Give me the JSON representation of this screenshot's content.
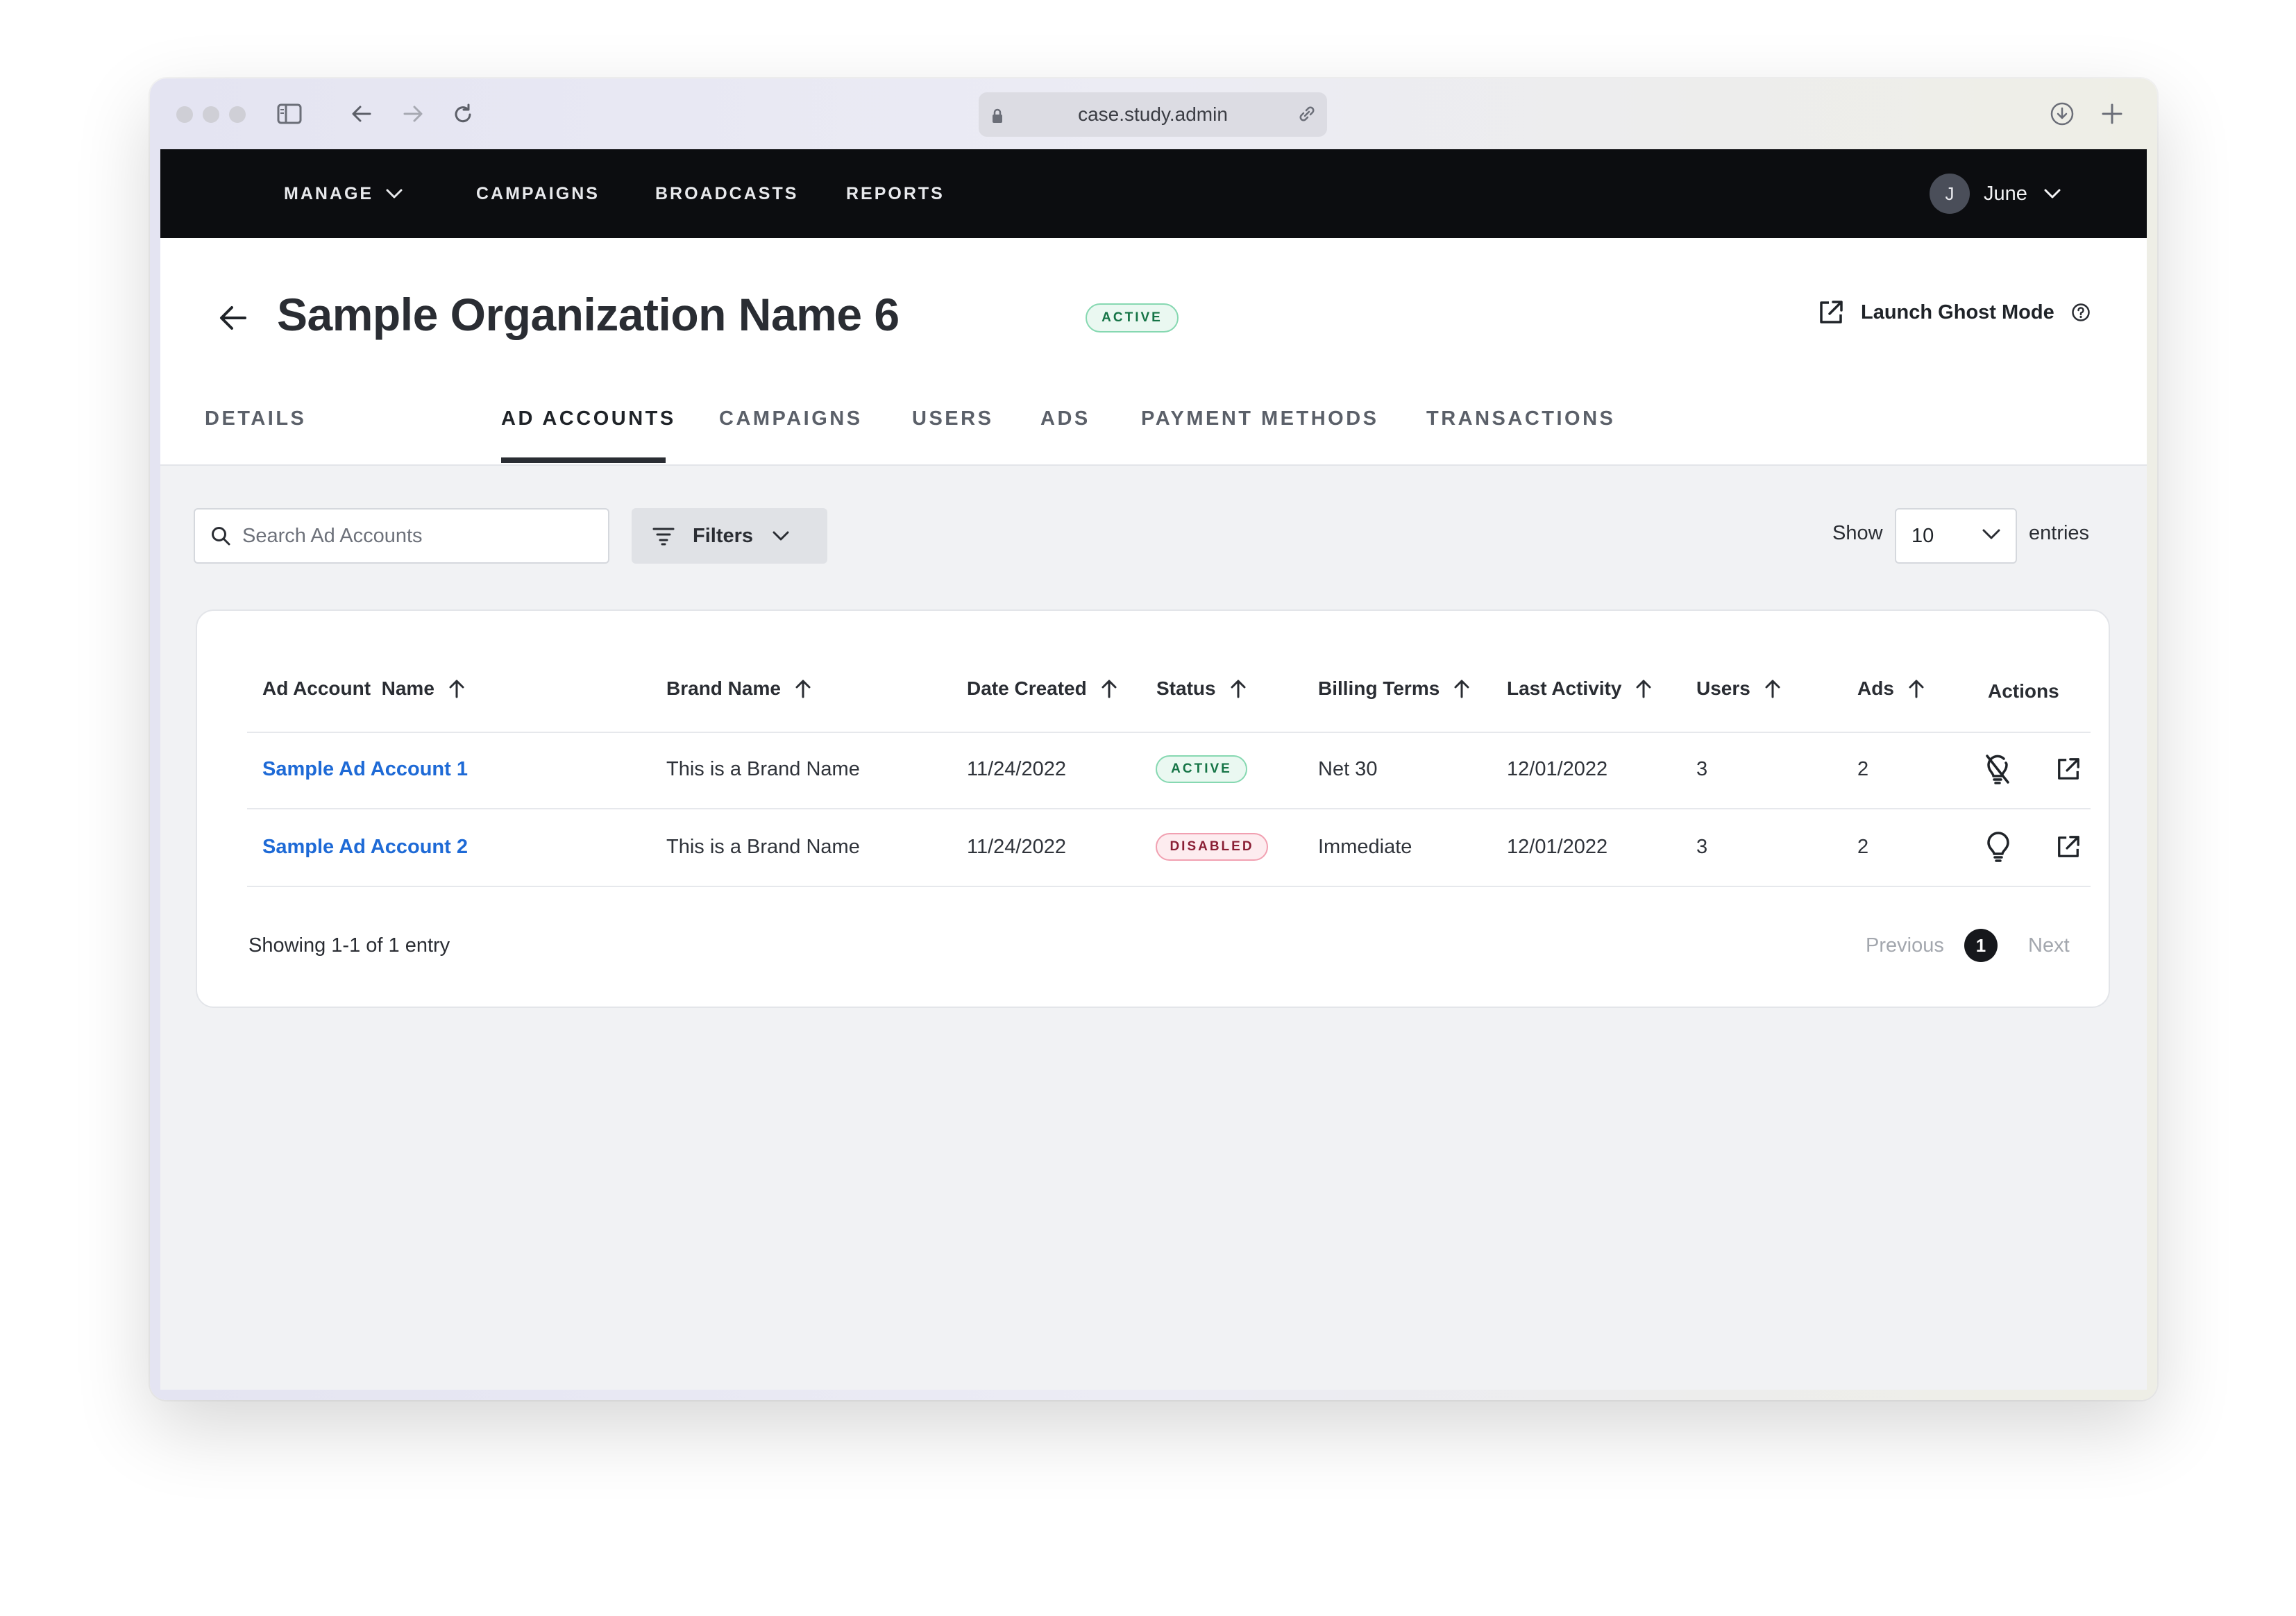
{
  "browser": {
    "url": "case.study.admin"
  },
  "topnav": {
    "items": [
      {
        "label": "MANAGE"
      },
      {
        "label": "CAMPAIGNS"
      },
      {
        "label": "BROADCASTS"
      },
      {
        "label": "REPORTS"
      }
    ],
    "user": {
      "initial": "J",
      "name": "June"
    }
  },
  "header": {
    "title": "Sample Organization Name 6",
    "status": "ACTIVE",
    "ghost_mode": "Launch Ghost Mode"
  },
  "tabs": [
    {
      "label": "DETAILS",
      "selected": false
    },
    {
      "label": "AD ACCOUNTS",
      "selected": true
    },
    {
      "label": "CAMPAIGNS",
      "selected": false
    },
    {
      "label": "USERS",
      "selected": false
    },
    {
      "label": "ADS",
      "selected": false
    },
    {
      "label": "PAYMENT METHODS",
      "selected": false
    },
    {
      "label": "TRANSACTIONS",
      "selected": false
    }
  ],
  "toolbar": {
    "search_placeholder": "Search Ad Accounts",
    "search_value": "",
    "filters_label": "Filters",
    "show_label": "Show",
    "page_size": "10",
    "entries_label": "entries"
  },
  "table": {
    "columns": [
      "Ad Account  Name",
      "Brand Name",
      "Date Created",
      "Status",
      "Billing Terms",
      "Last Activity",
      "Users",
      "Ads",
      "Actions"
    ],
    "rows": [
      {
        "name": "Sample Ad Account 1",
        "brand": "This is a Brand Name",
        "date_created": "11/24/2022",
        "status": "ACTIVE",
        "billing_terms": "Net 30",
        "last_activity": "12/01/2022",
        "users": "3",
        "ads": "2",
        "bulb_icon": "lightbulb-off-icon"
      },
      {
        "name": "Sample Ad Account 2",
        "brand": "This is a Brand Name",
        "date_created": "11/24/2022",
        "status": "DISABLED",
        "billing_terms": "Immediate",
        "last_activity": "12/01/2022",
        "users": "3",
        "ads": "2",
        "bulb_icon": "lightbulb-icon"
      }
    ]
  },
  "pagination": {
    "summary": "Showing 1-1 of 1 entry",
    "previous": "Previous",
    "current": "1",
    "next": "Next"
  },
  "colors": {
    "nav_bg": "#0c0d10",
    "link": "#1e6ad6",
    "active_badge": "#157446",
    "disabled_badge": "#8a1f35"
  }
}
